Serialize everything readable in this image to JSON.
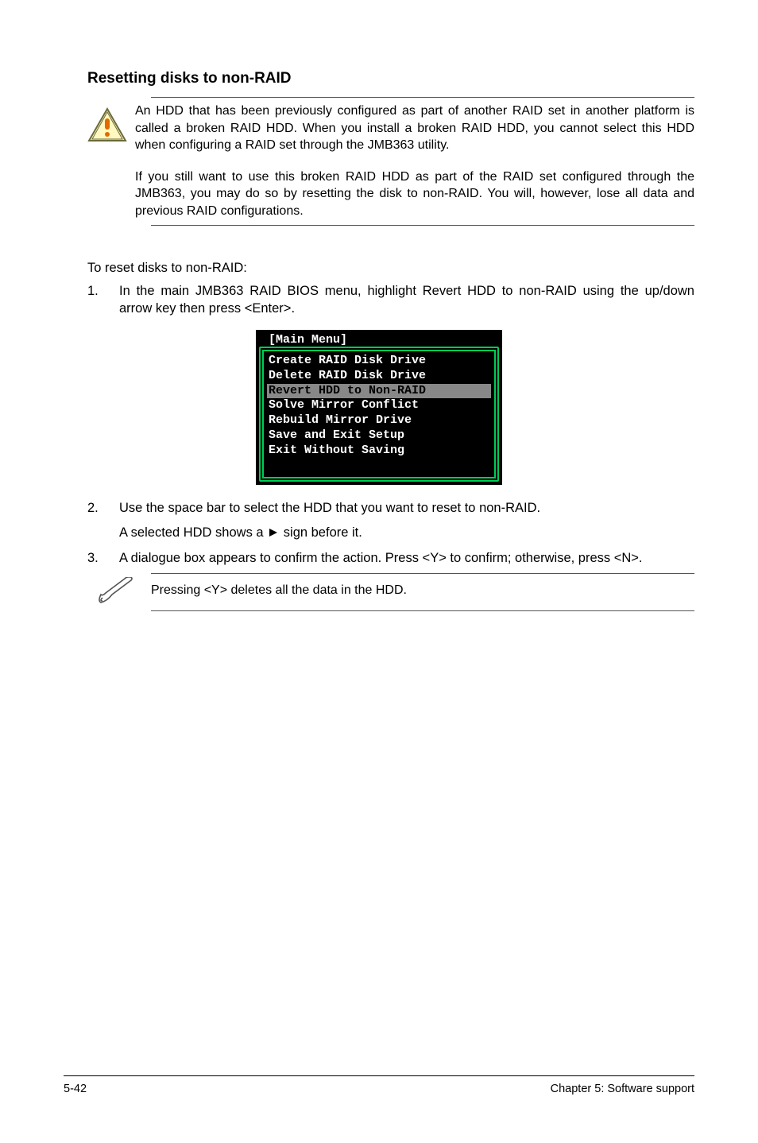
{
  "heading": "Resetting disks to non-RAID",
  "warning": {
    "p1": "An HDD that has been previously configured as part of another RAID set in another platform is called a broken RAID HDD. When you install a broken RAID HDD, you cannot select this HDD when configuring a RAID set through the JMB363 utility.",
    "p2": "If you still want to use this broken RAID HDD as part of the RAID set configured through the JMB363, you may do so by resetting the disk to non-RAID. You will, however, lose all data and previous RAID configurations."
  },
  "intro": "To reset disks to non-RAID:",
  "step1": {
    "num": "1.",
    "text": "In the main JMB363 RAID BIOS menu, highlight Revert HDD to non-RAID using the up/down arrow key then press <Enter>."
  },
  "terminal": {
    "title": "[Main Menu]",
    "lines": [
      "Create RAID Disk Drive",
      "Delete RAID Disk Drive",
      "Revert HDD to Non-RAID",
      "Solve Mirror Conflict",
      "Rebuild Mirror Drive",
      "Save and Exit Setup",
      "Exit Without Saving"
    ],
    "selected_index": 2
  },
  "step2": {
    "num": "2.",
    "line1": "Use the space bar to select the HDD that you want to reset to non-RAID.",
    "line2a": "A selected HDD shows a",
    "line2b": "sign before it."
  },
  "step3": {
    "num": "3.",
    "text": "A dialogue box appears to confirm the action. Press <Y> to confirm; otherwise, press <N>."
  },
  "note": "Pressing <Y> deletes all the data in the HDD.",
  "footer": {
    "left": "5-42",
    "right": "Chapter 5: Software support"
  },
  "icons": {
    "warning_name": "warning-triangle-icon",
    "note_name": "pencil-note-icon"
  }
}
